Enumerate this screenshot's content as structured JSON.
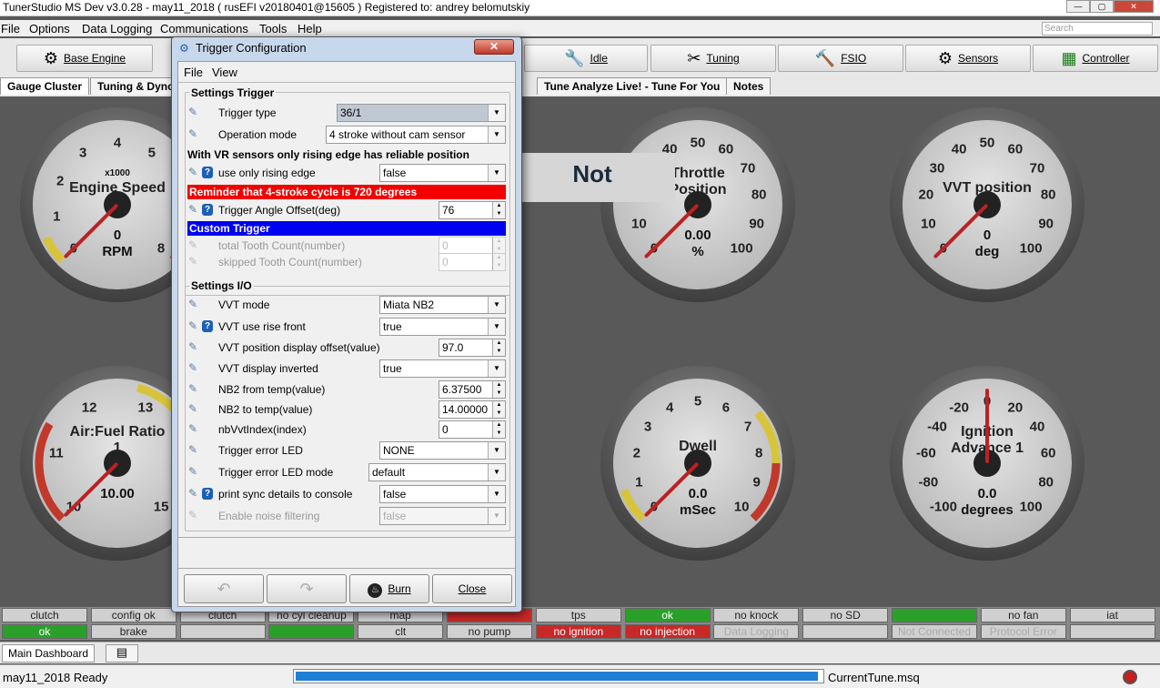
{
  "window": {
    "title": "TunerStudio MS Dev v3.0.28 - may11_2018 ( rusEFI v20180401@15605 ) Registered to: andrey belomutskiy"
  },
  "menu": [
    "File",
    "Options",
    "Data Logging",
    "Communications",
    "Tools",
    "Help"
  ],
  "search_placeholder": "Search",
  "toolbar": [
    {
      "label": "Base Engine",
      "icon": "gear-icon"
    },
    {
      "label": "Idle",
      "icon": "wrench-icon"
    },
    {
      "label": "Tuning",
      "icon": "tools-icon"
    },
    {
      "label": "FSIO",
      "icon": "hammer-icon"
    },
    {
      "label": "Sensors",
      "icon": "gear-icon"
    },
    {
      "label": "Controller",
      "icon": "chip-icon"
    }
  ],
  "tabs": [
    "Gauge Cluster",
    "Tuning & Dyno",
    "Tune Analyze Live! - Tune For You",
    "Notes"
  ],
  "not_connected": "Not Connected",
  "gauges": [
    {
      "title": "Engine Speed",
      "value": "0",
      "unit": "RPM",
      "sub": "x1000",
      "ticks": [
        "0",
        "1",
        "2",
        "3",
        "4",
        "5",
        "6",
        "7",
        "8"
      ],
      "fraction": 0.0
    },
    {
      "title": "Throttle Position",
      "value": "0.00",
      "unit": "%",
      "ticks": [
        "0",
        "10",
        "20",
        "30",
        "40",
        "50",
        "60",
        "70",
        "80",
        "90",
        "100"
      ],
      "fraction": 0.0
    },
    {
      "title": "VVT position",
      "value": "0",
      "unit": "deg",
      "ticks": [
        "0",
        "10",
        "20",
        "30",
        "40",
        "50",
        "60",
        "70",
        "80",
        "90",
        "100"
      ],
      "fraction": 0.0
    },
    {
      "title": "Air:Fuel Ratio 1",
      "value": "10.00",
      "unit": "",
      "ticks": [
        "10",
        "11",
        "12",
        "13",
        "14",
        "15"
      ],
      "fraction": 0.0
    },
    {
      "title": "Dwell",
      "value": "0.0",
      "unit": "mSec",
      "ticks": [
        "0",
        "1",
        "2",
        "3",
        "4",
        "5",
        "6",
        "7",
        "8",
        "9",
        "10"
      ],
      "fraction": 0.0
    },
    {
      "title": "Ignition Advance 1",
      "value": "0.0",
      "unit": "degrees",
      "ticks": [
        "-100",
        "-80",
        "-60",
        "-40",
        "-20",
        "0",
        "20",
        "40",
        "60",
        "80",
        "100"
      ],
      "fraction": 0.5
    }
  ],
  "status_row1": [
    {
      "text": "clutch",
      "style": ""
    },
    {
      "text": "config ok",
      "style": ""
    },
    {
      "text": "clutch",
      "style": ""
    },
    {
      "text": "no cyl cleanup",
      "style": ""
    },
    {
      "text": "map",
      "style": ""
    },
    {
      "text": "",
      "style": "red"
    },
    {
      "text": "tps",
      "style": ""
    },
    {
      "text": "ok",
      "style": "green"
    },
    {
      "text": "no knock",
      "style": ""
    },
    {
      "text": "no SD",
      "style": ""
    },
    {
      "text": "",
      "style": "green"
    },
    {
      "text": "no fan",
      "style": ""
    },
    {
      "text": "iat",
      "style": ""
    }
  ],
  "status_row2": [
    {
      "text": "ok",
      "style": "green"
    },
    {
      "text": "brake",
      "style": ""
    },
    {
      "text": "",
      "style": ""
    },
    {
      "text": "",
      "style": "green"
    },
    {
      "text": "clt",
      "style": ""
    },
    {
      "text": "no pump",
      "style": ""
    },
    {
      "text": "no ignition",
      "style": "red"
    },
    {
      "text": "no injection",
      "style": "red"
    },
    {
      "text": "Data Logging",
      "style": "dim"
    },
    {
      "text": "",
      "style": ""
    },
    {
      "text": "Not Connected",
      "style": "dim"
    },
    {
      "text": "Protocol Error",
      "style": "dim"
    },
    {
      "text": "",
      "style": ""
    }
  ],
  "bottom_tab": "Main Dashboard",
  "status_left": "may11_2018 Ready",
  "progress_fraction": 0.99,
  "status_file": "CurrentTune.msq",
  "dialog": {
    "title": "Trigger Configuration",
    "close": "✕",
    "menu": [
      "File",
      "View"
    ],
    "settings_trigger": "Settings Trigger",
    "trigger_type_label": "Trigger type",
    "trigger_type": "36/1",
    "operation_mode_label": "Operation mode",
    "operation_mode": "4 stroke without cam sensor",
    "vr_note": "With VR sensors only rising edge has reliable position",
    "rising_label": "use only rising edge",
    "rising": "false",
    "reminder": "Reminder that 4-stroke cycle is 720 degrees",
    "angle_offset_label": "Trigger Angle Offset(deg)",
    "angle_offset": "76",
    "custom_trigger": "Custom Trigger",
    "tooth_count_label": "total Tooth Count(number)",
    "tooth_count": "0",
    "skipped_label": "skipped Tooth Count(number)",
    "skipped": "0",
    "settings_io": "Settings I/O",
    "vvt_mode_label": "VVT mode",
    "vvt_mode": "Miata NB2",
    "vvt_rise_label": "VVT use rise front",
    "vvt_rise": "true",
    "vvt_offset_label": "VVT position display offset(value)",
    "vvt_offset": "97.0",
    "vvt_inv_label": "VVT display inverted",
    "vvt_inv": "true",
    "nb2_from_label": "NB2 from temp(value)",
    "nb2_from": "6.37500",
    "nb2_to_label": "NB2 to temp(value)",
    "nb2_to": "14.00000",
    "nbvvt_label": "nbVvtIndex(index)",
    "nbvvt": "0",
    "err_led_label": "Trigger error LED",
    "err_led": "NONE",
    "err_led_mode_label": "Trigger error LED mode",
    "err_led_mode": "default",
    "print_sync_label": "print sync details to console",
    "print_sync": "false",
    "noise_label": "Enable noise filtering",
    "noise": "false",
    "burn": "Burn",
    "close_btn": "Close"
  }
}
